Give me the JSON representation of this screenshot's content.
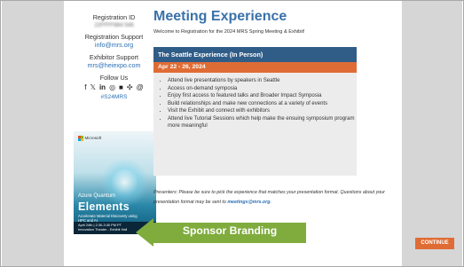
{
  "sidebar": {
    "registration_id_label": "Registration ID",
    "registration_id_value": "22FFFF884 546",
    "support_label": "Registration Support",
    "support_email": "info@mrs.org",
    "exhibitor_label": "Exhibitor Support",
    "exhibitor_email": "mrs@heiexpo.com",
    "follow_label": "Follow Us",
    "hashtag": "#S24MRS"
  },
  "social_icons": [
    "facebook-icon",
    "x-icon",
    "linkedin-icon",
    "instagram-icon",
    "youtube-icon",
    "bluesky-icon",
    "threads-icon"
  ],
  "ad": {
    "brand": "Microsoft",
    "line1": "Azure Quantum",
    "line2": "Elements",
    "line3": "Accelerate Material Discovery using HPC and AI",
    "line4": "April 24th | 2:30-3:30 PM PT",
    "line5": "Innovation Theater - Exhibit Hall"
  },
  "main": {
    "title": "Meeting Experience",
    "welcome": "Welcome to Registration for the 2024 MRS Spring Meeting & Exhibit!",
    "card_title": "The Seattle Experience (In Person)",
    "card_dates": "Apr 22 - 26, 2024",
    "bullets": [
      "Attend live presentations by speakers in Seattle",
      "Access on-demand symposia",
      "Enjoy first access to featured talks and Broader Impact Symposia",
      "Build relationships and make new connections at a variety of events",
      "Visit the Exhibit and connect with exhibitors",
      "Attend live Tutorial Sessions which help make the ensuing symposium program more meaningful"
    ],
    "presenters_text_1": "Presenters: Please be sure to pick the experience that matches your presentation format. Questions about",
    "presenters_text_2": "your presentation format may be sent to ",
    "presenters_email": "meetings@mrs.org",
    "presenters_end": "."
  },
  "annotation": {
    "label": "Sponsor Branding"
  },
  "buttons": {
    "continue": "CONTINUE"
  },
  "colors": {
    "accent_blue": "#3a71a8",
    "header_navy": "#305d87",
    "accent_orange": "#e06c35",
    "arrow_green": "#7fac3d"
  }
}
